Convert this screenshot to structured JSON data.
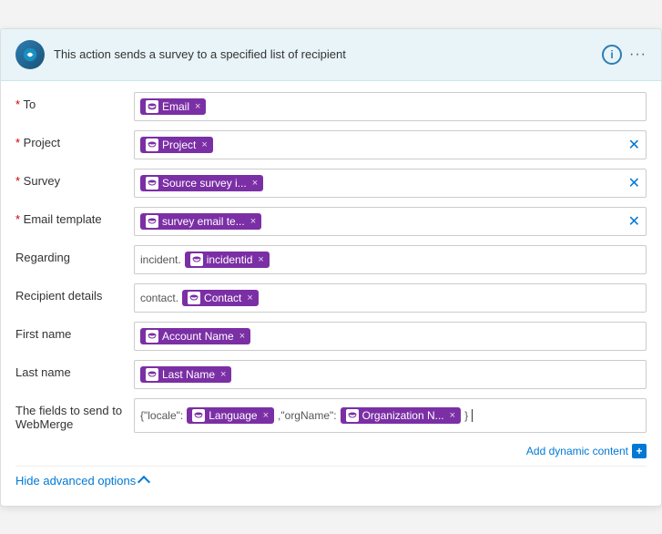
{
  "header": {
    "title": "This action sends a survey to a specified list of recipient",
    "info_label": "i",
    "more_label": "···"
  },
  "form": {
    "rows": [
      {
        "id": "to",
        "label": "* To",
        "required": true,
        "tokens": [
          {
            "text": "Email",
            "close": "×"
          }
        ],
        "prefix": "",
        "hasClear": false
      },
      {
        "id": "project",
        "label": "* Project",
        "required": true,
        "tokens": [
          {
            "text": "Project",
            "close": "×"
          }
        ],
        "prefix": "",
        "hasClear": true
      },
      {
        "id": "survey",
        "label": "* Survey",
        "required": true,
        "tokens": [
          {
            "text": "Source survey i...",
            "close": "×"
          }
        ],
        "prefix": "",
        "hasClear": true
      },
      {
        "id": "email-template",
        "label": "* Email template",
        "required": true,
        "tokens": [
          {
            "text": "survey email te...",
            "close": "×"
          }
        ],
        "prefix": "",
        "hasClear": true
      },
      {
        "id": "regarding",
        "label": "Regarding",
        "required": false,
        "tokens": [
          {
            "text": "incidentid",
            "close": "×"
          }
        ],
        "prefix": "incident.",
        "hasClear": false
      },
      {
        "id": "recipient-details",
        "label": "Recipient details",
        "required": false,
        "tokens": [
          {
            "text": "Contact",
            "close": "×"
          }
        ],
        "prefix": "contact.",
        "hasClear": false
      },
      {
        "id": "first-name",
        "label": "First name",
        "required": false,
        "tokens": [
          {
            "text": "Account Name",
            "close": "×"
          }
        ],
        "prefix": "",
        "hasClear": false
      },
      {
        "id": "last-name",
        "label": "Last name",
        "required": false,
        "tokens": [
          {
            "text": "Last Name",
            "close": "×"
          }
        ],
        "prefix": "",
        "hasClear": false
      }
    ],
    "webmerge": {
      "label": "The fields to send to WebMerge",
      "prefix1": "{\"locale\":",
      "token1": "Language",
      "token1_close": "×",
      "middle_text": ",\"orgName\":",
      "token2": "Organization N...",
      "token2_close": "×",
      "suffix": "}|"
    },
    "add_dynamic_label": "Add dynamic content",
    "add_dynamic_plus": "+",
    "hide_advanced_label": "Hide advanced options"
  }
}
